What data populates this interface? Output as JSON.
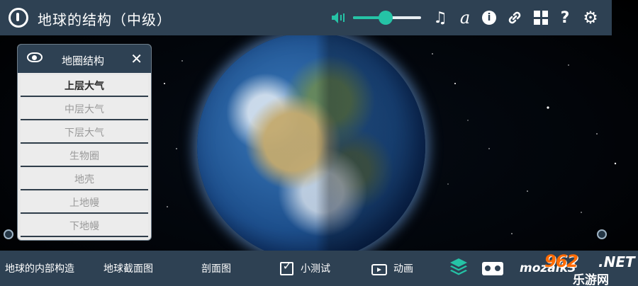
{
  "app": {
    "title": "地球的结构（中级）"
  },
  "toolbar": {
    "volume_level_percent": 48,
    "icons": [
      "power-icon",
      "volume-icon",
      "music-icon",
      "font-icon",
      "info-icon",
      "link-icon",
      "grid-icon",
      "help-icon",
      "gear-icon"
    ],
    "accent_color": "#25c3a6",
    "bar_color": "#2e4153",
    "info_glyph": "i",
    "help_glyph": "?",
    "music_glyph": "♫",
    "font_glyph": "a",
    "gear_glyph": "⚙",
    "link_glyph": "🔗"
  },
  "layer_panel": {
    "title": "地圈结构",
    "close_glyph": "✕",
    "items": [
      {
        "label": "上层大气",
        "active": true
      },
      {
        "label": "中层大气",
        "active": false
      },
      {
        "label": "下层大气",
        "active": false
      },
      {
        "label": "生物圈",
        "active": false
      },
      {
        "label": "地壳",
        "active": false
      },
      {
        "label": "上地幔",
        "active": false
      },
      {
        "label": "下地幔",
        "active": false
      }
    ]
  },
  "bottom_bar": {
    "items": [
      {
        "label": "地球的内部构造"
      },
      {
        "label": "地球截面图"
      },
      {
        "label": "剖面图"
      },
      {
        "label": "小测试",
        "icon": "quiz-check-icon"
      },
      {
        "label": "动画",
        "icon": "tv-icon"
      }
    ],
    "brand": "mozaik3"
  },
  "watermark": {
    "number": "962",
    "domain": ".NET",
    "text": "乐游网"
  }
}
